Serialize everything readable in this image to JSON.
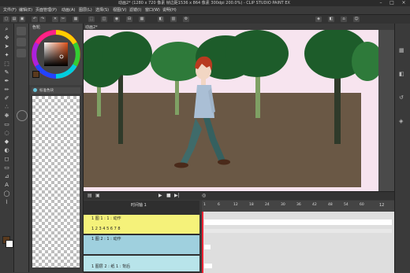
{
  "titlebar": {
    "title": "动画2* (1280 x 720 像素 帧边距1536 x 864 像素 300dpi 200.0%) - CLIP STUDIO PAINT EX"
  },
  "menubar": {
    "items": [
      "文件(F)",
      "编辑(E)",
      "页面管理(P)",
      "动画(A)",
      "图层(L)",
      "选择(S)",
      "视图(V)",
      "滤镜(I)",
      "窗口(W)",
      "说明(H)"
    ]
  },
  "canvas_tab": {
    "label": "动画2*"
  },
  "color_panel": {
    "tab_label": "色轮"
  },
  "layer_panel": {
    "blend_mode": "标准色块"
  },
  "timeline": {
    "timeline_name": "时间轴 1",
    "frame_numbers": [
      "1",
      "6",
      "12",
      "18",
      "24",
      "30",
      "36",
      "42",
      "48",
      "54",
      "60"
    ],
    "fps_label": "12",
    "tracks": [
      {
        "label": "1 图 1 : 1 : 动作",
        "cells": "1 2 3 4 5 6 7 8"
      },
      {
        "label": "1 图 2 : 1 : 动作",
        "cells": ""
      },
      {
        "label": "1 图层 2 : 纸 1 : 背后",
        "cells": ""
      }
    ]
  },
  "colors": {
    "sky": "#f7e4ef",
    "ground": "#6a5845",
    "tree_dark": "#1d5c2a",
    "tree_mid": "#2e7a3a",
    "hair": "#b83a1f",
    "shirt": "#aabfd5",
    "pants": "#3f6b6a",
    "track_yellow": "#f5f27a",
    "track_blue": "#9fd0de",
    "track_cyan": "#b8e4ea"
  }
}
